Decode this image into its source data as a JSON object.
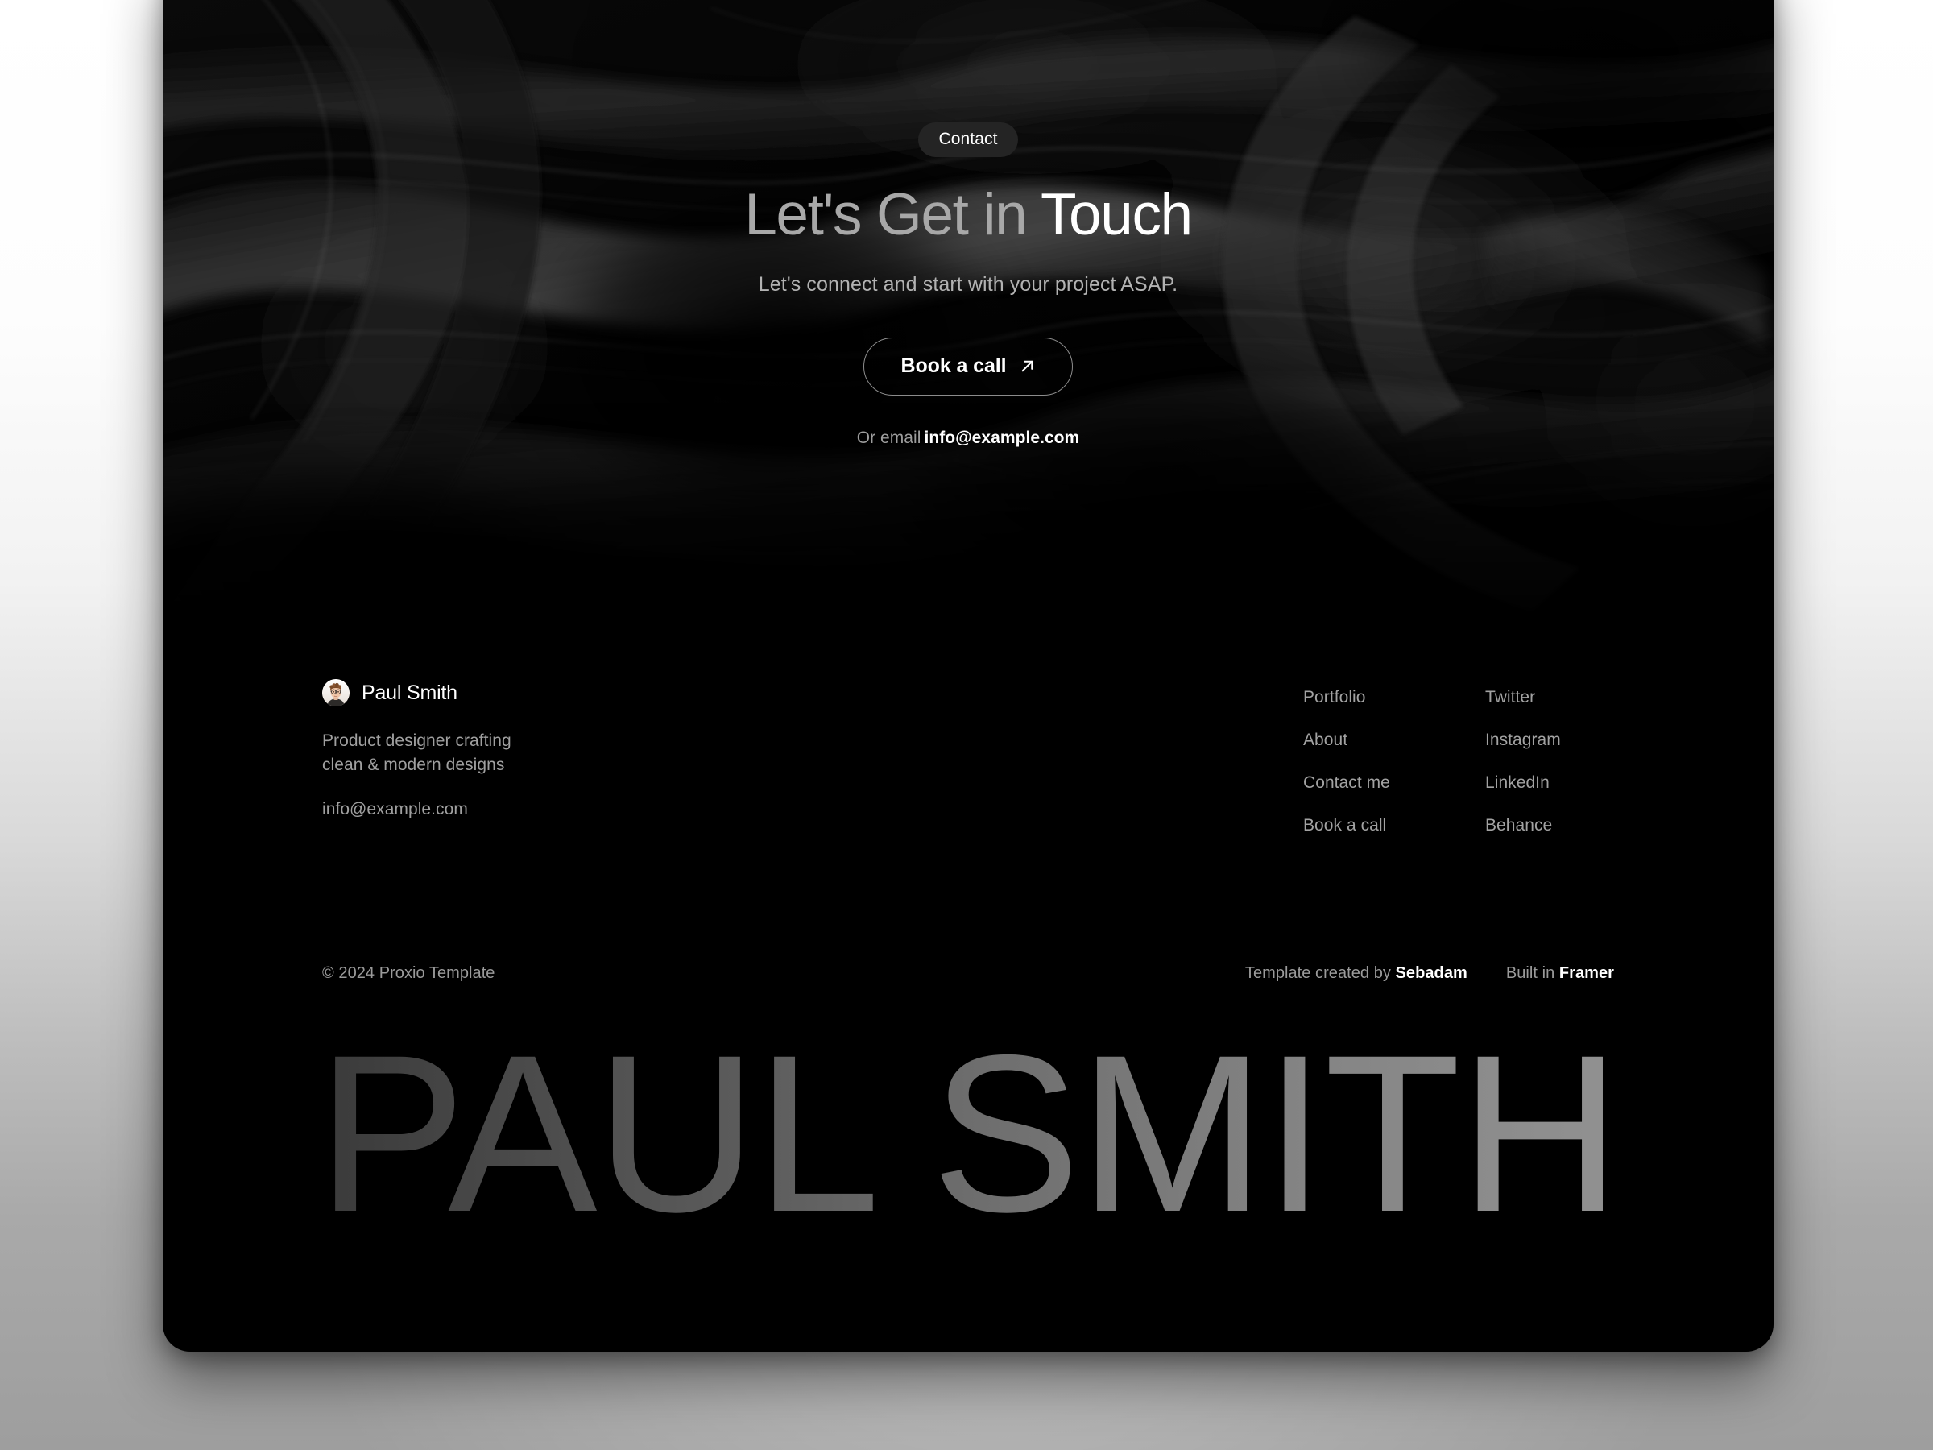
{
  "page": {
    "accent_white": "#ffffff",
    "bg_black": "#000000",
    "muted_text": "#a2a2a2"
  },
  "hero": {
    "badge": "Contact",
    "title_dim": "Let's Get in ",
    "title_bright": "Touch",
    "subtitle": "Let's connect and start with your project ASAP.",
    "cta_label": "Book a call",
    "cta_icon": "arrow-up-right-icon",
    "email_prefix": "Or email",
    "email": "info@example.com"
  },
  "footer": {
    "brand": {
      "avatar_icon": "user-avatar-photo",
      "name": "Paul Smith",
      "tagline_line1": "Product designer crafting",
      "tagline_line2": "clean & modern designs",
      "email": "info@example.com"
    },
    "links_primary": [
      {
        "label": "Portfolio"
      },
      {
        "label": "About"
      },
      {
        "label": "Contact me"
      },
      {
        "label": "Book a call"
      }
    ],
    "links_social": [
      {
        "label": "Twitter"
      },
      {
        "label": "Instagram"
      },
      {
        "label": "LinkedIn"
      },
      {
        "label": "Behance"
      }
    ],
    "copyright": "© 2024 Proxio Template",
    "credit_template_prefix": "Template created by ",
    "credit_template_author": "Sebadam",
    "credit_built_prefix": "Built in ",
    "credit_built_platform": "Framer",
    "wordmark": "PAUL SMITH"
  }
}
